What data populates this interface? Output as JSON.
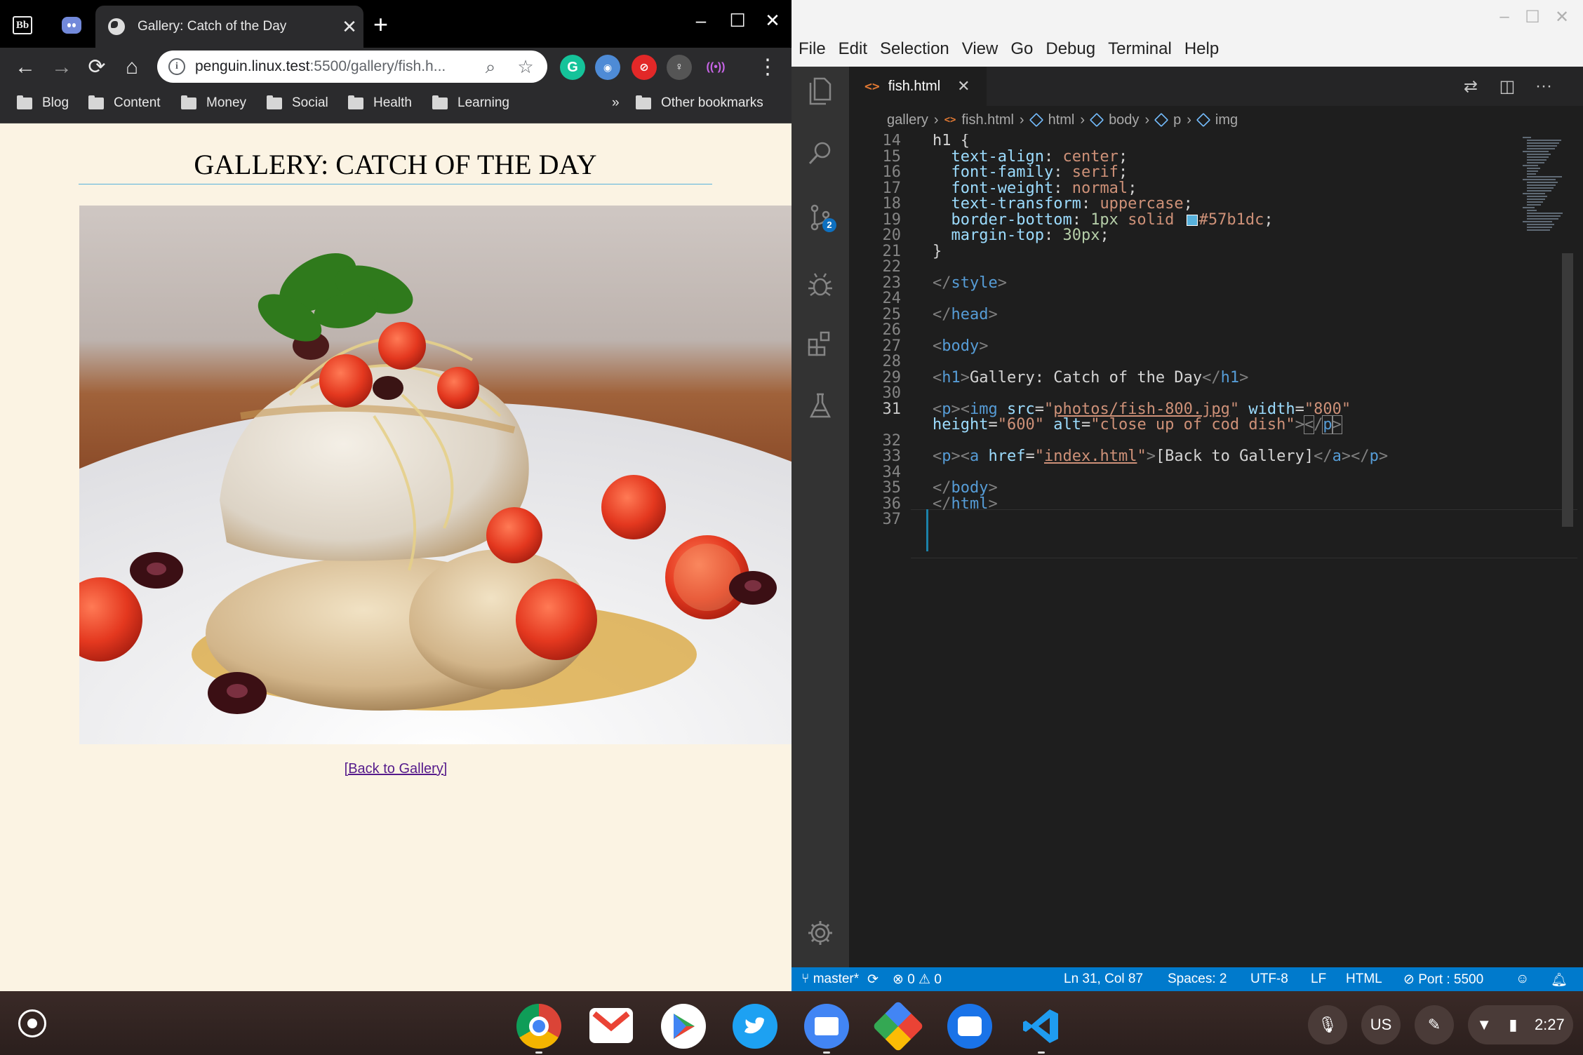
{
  "chrome": {
    "tab_title": "Gallery: Catch of the Day",
    "url_host": "penguin.linux.test",
    "url_rest": ":5500/gallery/fish.h...",
    "bookmarks": [
      "Blog",
      "Content",
      "Money",
      "Social",
      "Health",
      "Learning"
    ],
    "overflow": "»",
    "other_bookmarks": "Other bookmarks"
  },
  "page": {
    "heading": "Gallery: Catch of the Day",
    "image_alt": "close up of cod dish",
    "back_link": "[Back to Gallery]"
  },
  "vscode": {
    "menu": [
      "File",
      "Edit",
      "Selection",
      "View",
      "Go",
      "Debug",
      "Terminal",
      "Help"
    ],
    "tab_label": "fish.html",
    "scm_badge": "2",
    "breadcrumb": [
      "gallery",
      "fish.html",
      "html",
      "body",
      "p",
      "img"
    ],
    "status": {
      "branch": "master*",
      "problems_errors": "0",
      "problems_warnings": "0",
      "cursor": "Ln 31, Col 87",
      "spaces": "Spaces: 2",
      "encoding": "UTF-8",
      "eol": "LF",
      "language": "HTML",
      "port": "Port : 5500"
    },
    "lines": [
      {
        "n": "14",
        "html": "<span class='t-text'>h1 {</span>"
      },
      {
        "n": "15",
        "html": "  <span class='t-prop'>text-align</span>: <span class='t-val'>center</span>;"
      },
      {
        "n": "16",
        "html": "  <span class='t-prop'>font-family</span>: <span class='t-val'>serif</span>;"
      },
      {
        "n": "17",
        "html": "  <span class='t-prop'>font-weight</span>: <span class='t-val'>normal</span>;"
      },
      {
        "n": "18",
        "html": "  <span class='t-prop'>text-transform</span>: <span class='t-val'>uppercase</span>;"
      },
      {
        "n": "19",
        "html": "  <span class='t-prop'>border-bottom</span>: <span class='t-num'>1px</span> <span class='t-val'>solid</span> <span class='swatch'></span><span class='t-val'>#57b1dc</span>;"
      },
      {
        "n": "20",
        "html": "  <span class='t-prop'>margin-top</span>: <span class='t-num'>30px</span>;"
      },
      {
        "n": "21",
        "html": "}"
      },
      {
        "n": "22",
        "html": ""
      },
      {
        "n": "23",
        "html": "<span class='t-tag'>&lt;/</span><span class='t-name'>style</span><span class='t-tag'>&gt;</span>"
      },
      {
        "n": "24",
        "html": ""
      },
      {
        "n": "25",
        "html": "<span class='t-tag'>&lt;/</span><span class='t-name'>head</span><span class='t-tag'>&gt;</span>"
      },
      {
        "n": "26",
        "html": ""
      },
      {
        "n": "27",
        "html": "<span class='t-tag'>&lt;</span><span class='t-name'>body</span><span class='t-tag'>&gt;</span>"
      },
      {
        "n": "28",
        "html": ""
      },
      {
        "n": "29",
        "html": "<span class='t-tag'>&lt;</span><span class='t-name'>h1</span><span class='t-tag'>&gt;</span>Gallery: Catch of the Day<span class='t-tag'>&lt;/</span><span class='t-name'>h1</span><span class='t-tag'>&gt;</span>"
      },
      {
        "n": "30",
        "html": ""
      },
      {
        "n": "31",
        "html": "<span class='t-tag'>&lt;</span><span class='t-name'>p</span><span class='t-tag'>&gt;&lt;</span><span class='t-name'>img</span> <span class='t-attr'>src</span>=<span class='t-str'>\"</span><span class='t-link'>photos/fish-800.jpg</span><span class='t-str'>\"</span> <span class='t-attr'>width</span>=<span class='t-str'>\"800\"</span>"
      },
      {
        "n": "",
        "html": "<span class='t-attr'>height</span>=<span class='t-str'>\"600\"</span> <span class='t-attr'>alt</span>=<span class='t-str'>\"close up of cod dish\"</span><span class='t-tag'>&gt;</span><span class='t-tag' style='outline:1px solid #888'>&lt;</span><span class='t-tag'>/</span><span class='t-name' style='outline:1px solid #888'>p</span><span class='t-tag' style='outline:1px solid #888'>&gt;</span>"
      },
      {
        "n": "32",
        "html": ""
      },
      {
        "n": "33",
        "html": "<span class='t-tag'>&lt;</span><span class='t-name'>p</span><span class='t-tag'>&gt;&lt;</span><span class='t-name'>a</span> <span class='t-attr'>href</span>=<span class='t-str'>\"</span><span class='t-link'>index.html</span><span class='t-str'>\"</span><span class='t-tag'>&gt;</span>[Back to Gallery]<span class='t-tag'>&lt;/</span><span class='t-name'>a</span><span class='t-tag'>&gt;&lt;/</span><span class='t-name'>p</span><span class='t-tag'>&gt;</span>"
      },
      {
        "n": "34",
        "html": ""
      },
      {
        "n": "35",
        "html": "<span class='t-tag'>&lt;/</span><span class='t-name'>body</span><span class='t-tag'>&gt;</span>"
      },
      {
        "n": "36",
        "html": "<span class='t-tag'>&lt;/</span><span class='t-name'>html</span><span class='t-tag'>&gt;</span>"
      },
      {
        "n": "37",
        "html": ""
      }
    ]
  },
  "shelf": {
    "ime": "US",
    "time": "2:27"
  },
  "colors": {
    "page_bg": "#fbf3e3",
    "h1_border": "#57b1dc",
    "status_bar": "#007acc",
    "link": "#551a8b"
  }
}
